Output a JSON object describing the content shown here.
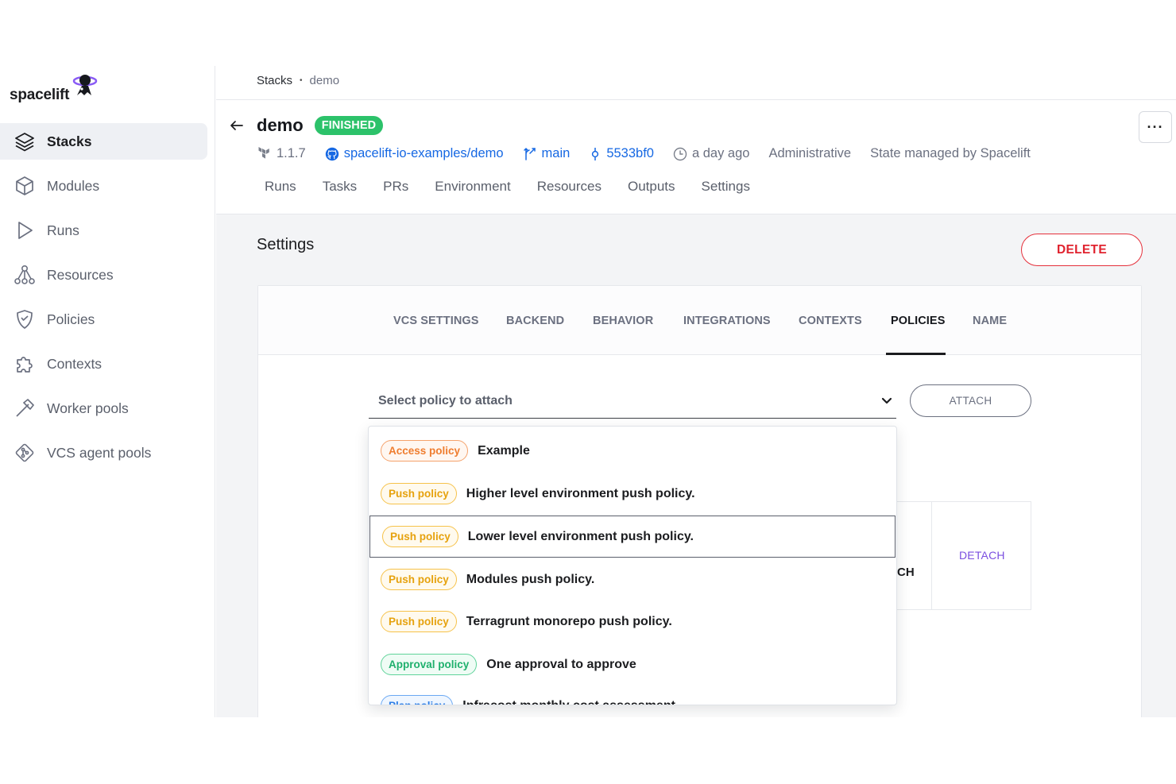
{
  "app": {
    "logo_text": "spacelift"
  },
  "sidebar": {
    "items": [
      {
        "label": "Stacks",
        "icon": "layers-icon",
        "active": true
      },
      {
        "label": "Modules",
        "icon": "cube-icon",
        "active": false
      },
      {
        "label": "Runs",
        "icon": "play-icon",
        "active": false
      },
      {
        "label": "Resources",
        "icon": "nodes-icon",
        "active": false
      },
      {
        "label": "Policies",
        "icon": "shield-icon",
        "active": false
      },
      {
        "label": "Contexts",
        "icon": "puzzle-icon",
        "active": false
      },
      {
        "label": "Worker pools",
        "icon": "hammer-icon",
        "active": false
      },
      {
        "label": "VCS agent pools",
        "icon": "git-icon",
        "active": false
      }
    ]
  },
  "breadcrumb": {
    "root": "Stacks",
    "separator": "•",
    "current": "demo"
  },
  "stack": {
    "name": "demo",
    "status": "FINISHED",
    "version": "1.1.7",
    "repo": "spacelift-io-examples/demo",
    "branch": "main",
    "commit": "5533bf0",
    "updated": "a day ago",
    "role": "Administrative",
    "state": "State managed by Spacelift"
  },
  "stack_tabs": [
    "Runs",
    "Tasks",
    "PRs",
    "Environment",
    "Resources",
    "Outputs",
    "Settings"
  ],
  "more_label": "···",
  "settings": {
    "title": "Settings",
    "delete_label": "DELETE",
    "tabs": [
      "VCS SETTINGS",
      "BACKEND",
      "BEHAVIOR",
      "INTEGRATIONS",
      "CONTEXTS",
      "POLICIES",
      "NAME"
    ],
    "active_tab": "POLICIES",
    "select_placeholder": "Select policy to attach",
    "attach_label": "ATTACH",
    "background_fragment": "CH",
    "detach_label": "DETACH"
  },
  "dropdown": {
    "options": [
      {
        "type": "Access policy",
        "kind": "access",
        "name": "Example"
      },
      {
        "type": "Push policy",
        "kind": "push",
        "name": "Higher level environment push policy."
      },
      {
        "type": "Push policy",
        "kind": "push",
        "name": "Lower level environment push policy.",
        "highlighted": true
      },
      {
        "type": "Push policy",
        "kind": "push",
        "name": "Modules push policy."
      },
      {
        "type": "Push policy",
        "kind": "push",
        "name": "Terragrunt monorepo push policy."
      },
      {
        "type": "Approval policy",
        "kind": "approval",
        "name": "One approval to approve"
      },
      {
        "type": "Plan policy",
        "kind": "plan",
        "name": "Infracost monthly cost assessment"
      }
    ]
  },
  "colors": {
    "finished": "#2cc26a",
    "link": "#1668e3",
    "danger": "#e0222e",
    "detach": "#7b4fe0"
  }
}
